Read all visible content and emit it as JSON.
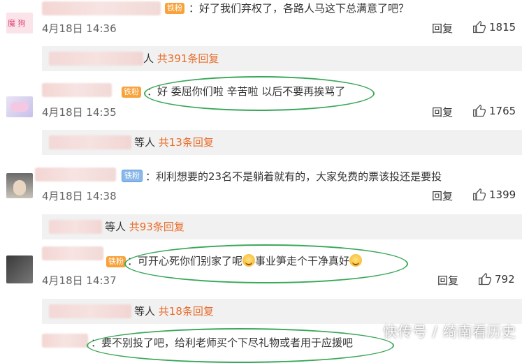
{
  "comments": [
    {
      "badge": "铁粉",
      "text": "：好了我们弃权了，各路人马这下总满意了吧？",
      "time": "4月18日 14:36",
      "reply": "回复",
      "likes": "1815",
      "sub_people": "人",
      "sub_count": "共391条回复",
      "avatar_text": "魔 狗"
    },
    {
      "badge": "铁粉",
      "text": "：好 委屈你们啦 辛苦啦 以后不要再挨骂了",
      "time": "4月18日 14:35",
      "reply": "回复",
      "likes": "1765",
      "sub_people": "等人",
      "sub_count": "共13条回复"
    },
    {
      "badge": "铁粉",
      "text": "：利利想要的23名不是躺着就有的，大家免费的票该投还是要投",
      "time": "4月18日 14:38",
      "reply": "回复",
      "likes": "1399",
      "sub_people": "等人",
      "sub_count": "共93条回复"
    },
    {
      "badge": "铁粉",
      "text_a": "：可开心死你们别家了呢",
      "text_b": "事业笋走个干净真好",
      "time": "4月18日 14:37",
      "reply": "回复",
      "likes": "792",
      "sub_people": "等人",
      "sub_count": "共18条回复"
    },
    {
      "text": "：要不别投了吧，给利老师买个下尽礼物或者用于应援吧"
    }
  ],
  "watermark": "快传号 / 绮南看历史",
  "colors": {
    "accent": "#e86c2a",
    "highlight": "#3aa85a"
  }
}
